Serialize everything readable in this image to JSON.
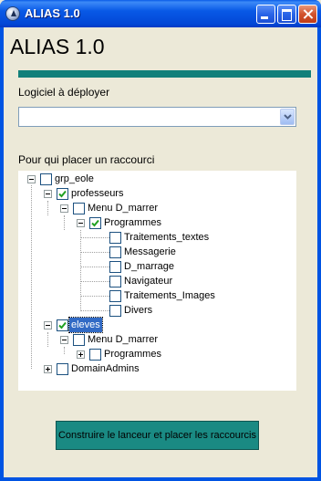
{
  "window": {
    "title": "ALIAS 1.0"
  },
  "main": {
    "heading": "ALIAS 1.0",
    "software_label": "Logiciel à déployer",
    "software_value": "",
    "shortcut_label": "Pour qui placer un raccourci",
    "build_button": "Construire le lanceur et placer les raccourcis"
  },
  "tree": {
    "root": {
      "label": "grp_eole",
      "checked": false,
      "expanded": true
    },
    "professeurs": {
      "label": "professeurs",
      "checked": true,
      "expanded": true
    },
    "prof_menu": {
      "label": "Menu D_marrer",
      "checked": false,
      "expanded": true
    },
    "prof_programmes": {
      "label": "Programmes",
      "checked": true,
      "expanded": true
    },
    "prof_items": [
      {
        "label": "Traitements_textes",
        "checked": false
      },
      {
        "label": "Messagerie",
        "checked": false
      },
      {
        "label": "D_marrage",
        "checked": false
      },
      {
        "label": "Navigateur",
        "checked": false
      },
      {
        "label": "Traitements_Images",
        "checked": false
      },
      {
        "label": "Divers",
        "checked": false
      }
    ],
    "eleves": {
      "label": "eleves",
      "checked": true,
      "expanded": true,
      "selected": true
    },
    "eleves_menu": {
      "label": "Menu D_marrer",
      "checked": false,
      "expanded": true
    },
    "eleves_programmes": {
      "label": "Programmes",
      "checked": false,
      "expanded": false
    },
    "domainadmins": {
      "label": "DomainAdmins",
      "checked": false,
      "expanded": false
    }
  },
  "colors": {
    "accent": "#12807a",
    "button": "#1a8a83",
    "selection": "#316ac5",
    "title_bar": "#0054e3"
  }
}
